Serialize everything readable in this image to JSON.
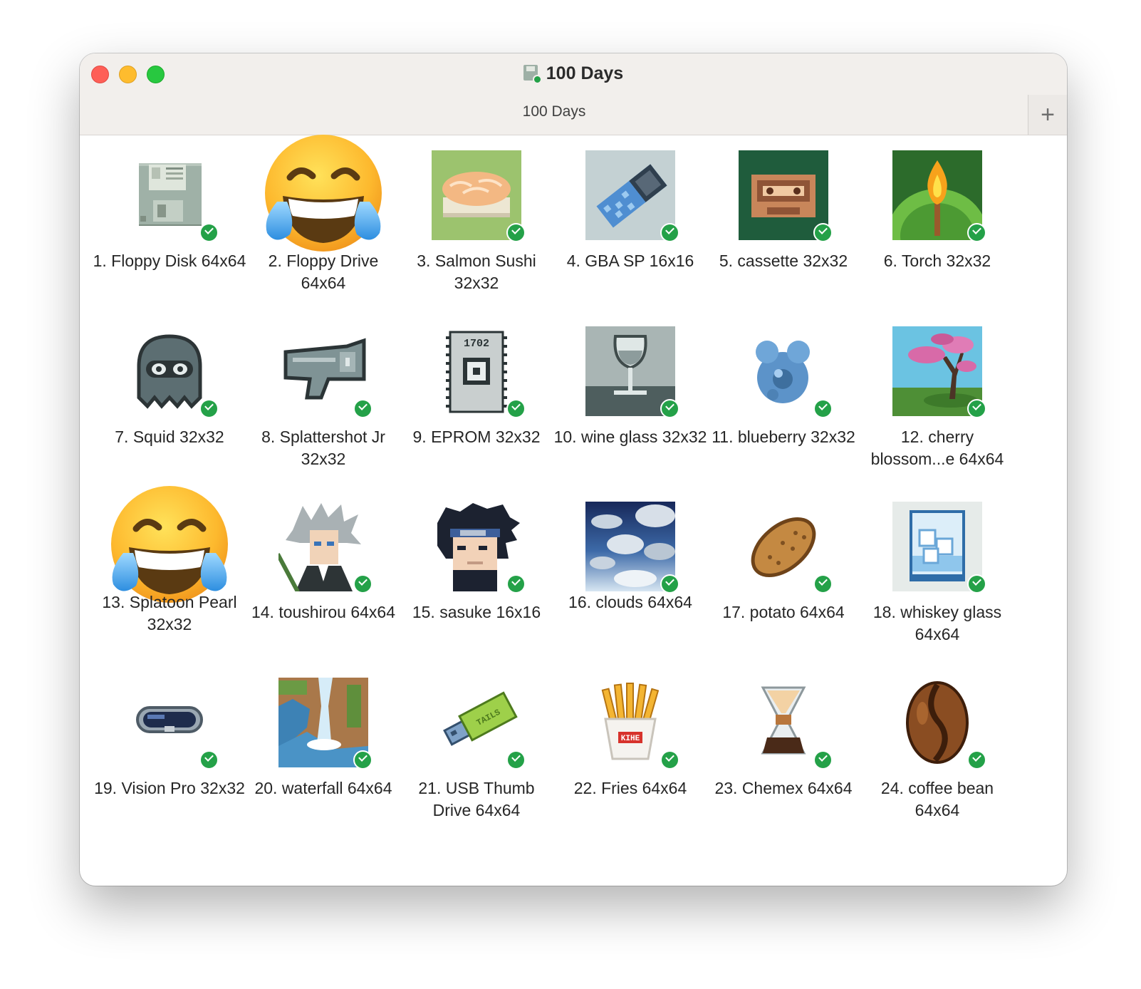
{
  "window": {
    "title": "100 Days",
    "tab_label": "100 Days",
    "add_tab_symbol": "+"
  },
  "items": [
    {
      "caption": "1. Floppy Disk 64x64",
      "icon": "floppy-disk-icon",
      "status": "synced"
    },
    {
      "caption": "2. Floppy Drive 64x64",
      "icon": "face-with-tears-of-joy-emoji",
      "status": "none"
    },
    {
      "caption": "3. Salmon Sushi 32x32",
      "icon": "salmon-sushi-icon",
      "status": "synced"
    },
    {
      "caption": "4. GBA SP 16x16",
      "icon": "gba-sp-icon",
      "status": "synced"
    },
    {
      "caption": "5. cassette 32x32",
      "icon": "cassette-icon",
      "status": "synced"
    },
    {
      "caption": "6. Torch 32x32",
      "icon": "torch-icon",
      "status": "synced"
    },
    {
      "caption": "7. Squid 32x32",
      "icon": "squid-icon",
      "status": "synced"
    },
    {
      "caption": "8. Splattershot Jr 32x32",
      "icon": "splattershot-icon",
      "status": "synced"
    },
    {
      "caption": "9. EPROM 32x32",
      "icon": "eprom-chip-icon",
      "status": "synced"
    },
    {
      "caption": "10. wine glass 32x32",
      "icon": "wine-glass-icon",
      "status": "synced"
    },
    {
      "caption": "11. blueberry 32x32",
      "icon": "blueberry-icon",
      "status": "synced"
    },
    {
      "caption": "12. cherry blossom...e 64x64",
      "icon": "cherry-blossom-tree-icon",
      "status": "synced"
    },
    {
      "caption": "13. Splatoon Pearl 32x32",
      "icon": "face-with-tears-of-joy-emoji",
      "status": "none"
    },
    {
      "caption": "14. toushirou 64x64",
      "icon": "toushirou-portrait-icon",
      "status": "synced"
    },
    {
      "caption": "15. sasuke 16x16",
      "icon": "sasuke-portrait-icon",
      "status": "synced"
    },
    {
      "caption": "16. clouds 64x64",
      "icon": "clouds-icon",
      "status": "synced"
    },
    {
      "caption": "17. potato 64x64",
      "icon": "potato-icon",
      "status": "synced"
    },
    {
      "caption": "18. whiskey glass 64x64",
      "icon": "whiskey-glass-icon",
      "status": "synced"
    },
    {
      "caption": "19. Vision Pro 32x32",
      "icon": "vision-pro-icon",
      "status": "synced"
    },
    {
      "caption": "20. waterfall 64x64",
      "icon": "waterfall-icon",
      "status": "synced"
    },
    {
      "caption": "21. USB Thumb Drive 64x64",
      "icon": "usb-thumb-drive-icon",
      "status": "synced"
    },
    {
      "caption": "22. Fries 64x64",
      "icon": "fries-icon",
      "status": "synced"
    },
    {
      "caption": "23. Chemex 64x64",
      "icon": "chemex-icon",
      "status": "synced"
    },
    {
      "caption": "24. coffee bean 64x64",
      "icon": "coffee-bean-icon",
      "status": "synced"
    }
  ],
  "thumb_texts": {
    "eprom_label": "1702",
    "usb_label": "TAILS",
    "fries_label": "KIHE"
  },
  "colors": {
    "close": "#fe5f57",
    "minimize": "#febc2e",
    "zoom": "#28c840",
    "sync_badge": "#24a148"
  }
}
